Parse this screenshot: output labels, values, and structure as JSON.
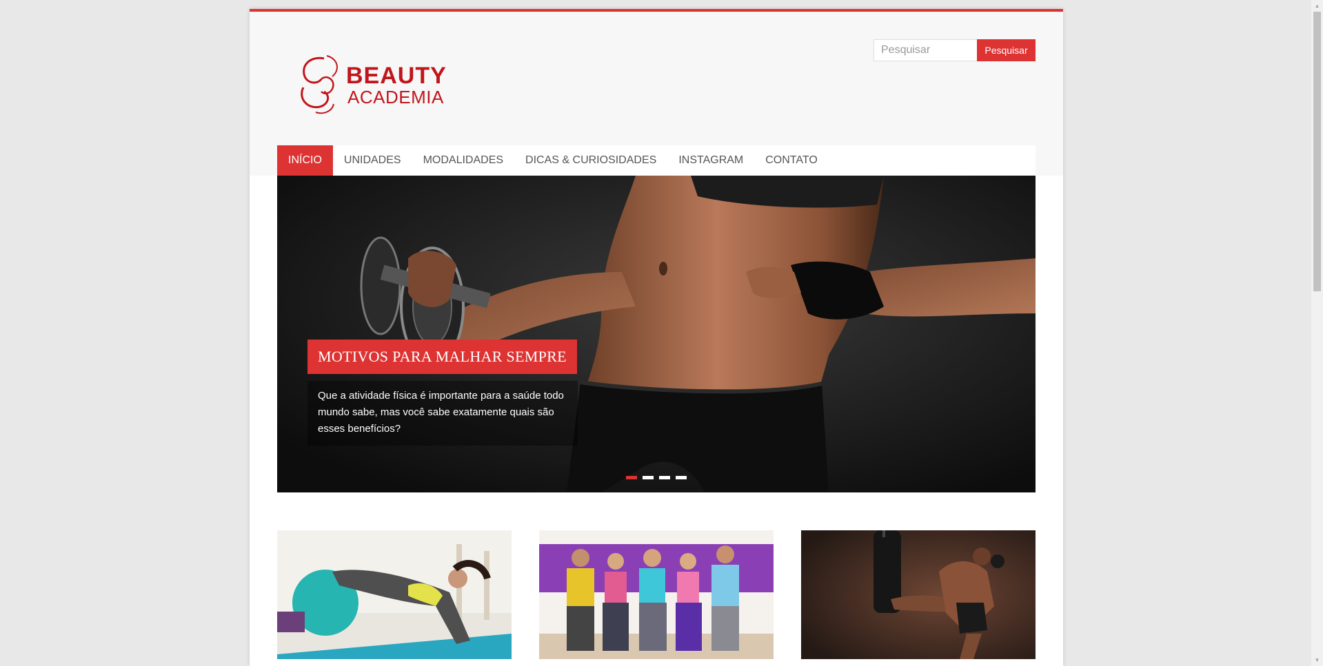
{
  "brand": {
    "logo_line1": "BEAUTY",
    "logo_line2": "ACADEMIA",
    "accent_color": "#dd3333",
    "logo_color": "#c0161b"
  },
  "search": {
    "placeholder": "Pesquisar",
    "button_label": "Pesquisar"
  },
  "nav": {
    "items": [
      {
        "label": "INÍCIO",
        "active": true
      },
      {
        "label": "UNIDADES",
        "active": false
      },
      {
        "label": "MODALIDADES",
        "active": false
      },
      {
        "label": "DICAS & CURIOSIDADES",
        "active": false
      },
      {
        "label": "INSTAGRAM",
        "active": false
      },
      {
        "label": "CONTATO",
        "active": false
      }
    ]
  },
  "slider": {
    "title": "MOTIVOS PARA MALHAR SEMPRE",
    "text": "Que a atividade física é importante para a saúde todo mundo sabe, mas você sabe exatamente quais são esses benefícios?",
    "slide_count": 4,
    "active_slide": 1
  },
  "thumbnails": [
    {
      "icon": "pilates-image"
    },
    {
      "icon": "dance-class-image"
    },
    {
      "icon": "muay-thai-image"
    }
  ]
}
